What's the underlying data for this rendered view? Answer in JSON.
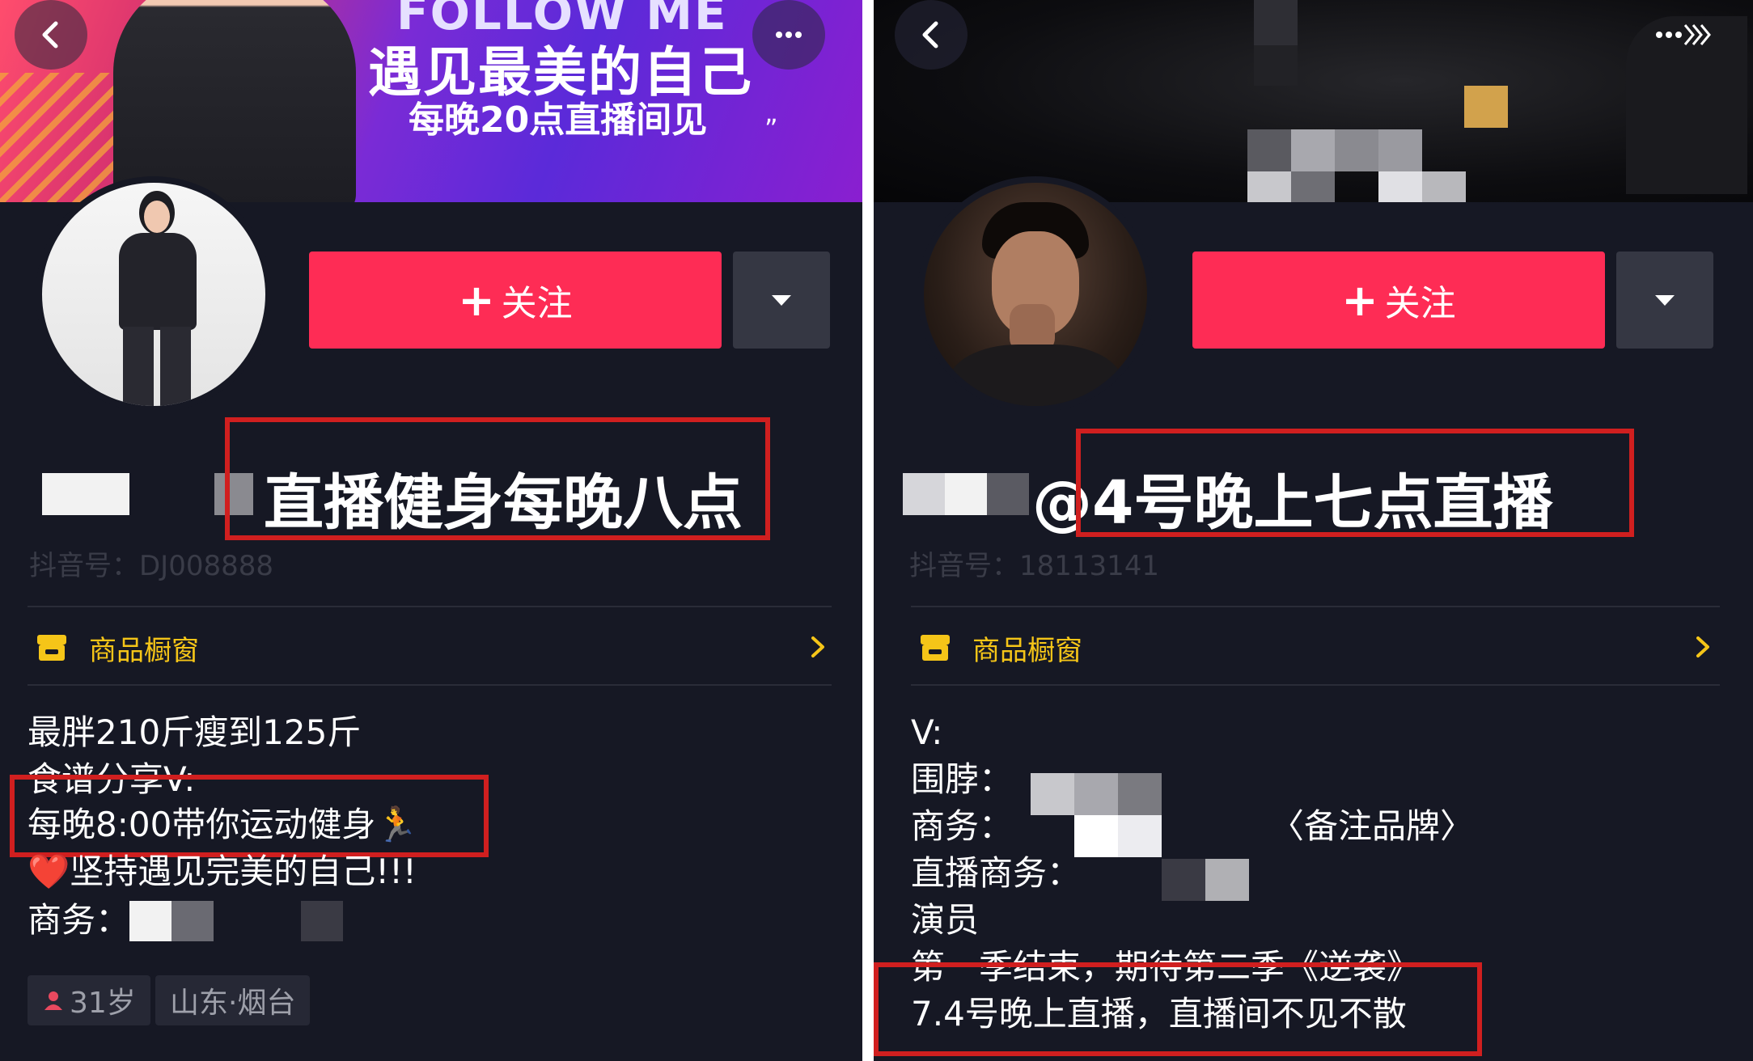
{
  "left": {
    "banner": {
      "follow_text": "FOLLOW ME",
      "headline": "遇见最美的自己",
      "subline": "每晚20点直播间见",
      "quote_mark": "”"
    },
    "follow_button": {
      "plus": "+",
      "label": "关注"
    },
    "nickname": "直播健身每晚八点",
    "douyin_id": "抖音号：DJ008888",
    "shop_window": "商品橱窗",
    "bio": [
      "最胖210斤瘦到125斤",
      "食谱分享V:",
      "每晚8:00带你运动健身🏃",
      "❤️坚持遇见完美的自己!!!",
      "商务："
    ],
    "tags": {
      "age": "31岁",
      "location": "山东·烟台"
    }
  },
  "right": {
    "follow_button": {
      "plus": "+",
      "label": "关注"
    },
    "nickname": "@4号晚上七点直播",
    "douyin_id": "抖音号：18113141",
    "shop_window": "商品橱窗",
    "bio": [
      "V:",
      "围脖：",
      "商务：",
      "直播商务：",
      "演员",
      "第一季结束，期待第二季《逆袭》",
      "7.4号晚上直播，直播间不见不散"
    ],
    "bio_brand_note": "〈备注品牌〉"
  },
  "colors": {
    "follow_red": "#fe2c55",
    "shop_yellow": "#f5c518",
    "highlight_red": "#d01f1f",
    "background": "#161824"
  },
  "icons": [
    "back-arrow-icon",
    "more-dots-icon",
    "share-arrows-icon",
    "triangle-down-icon",
    "shop-icon",
    "chevron-right-icon",
    "person-icon"
  ]
}
